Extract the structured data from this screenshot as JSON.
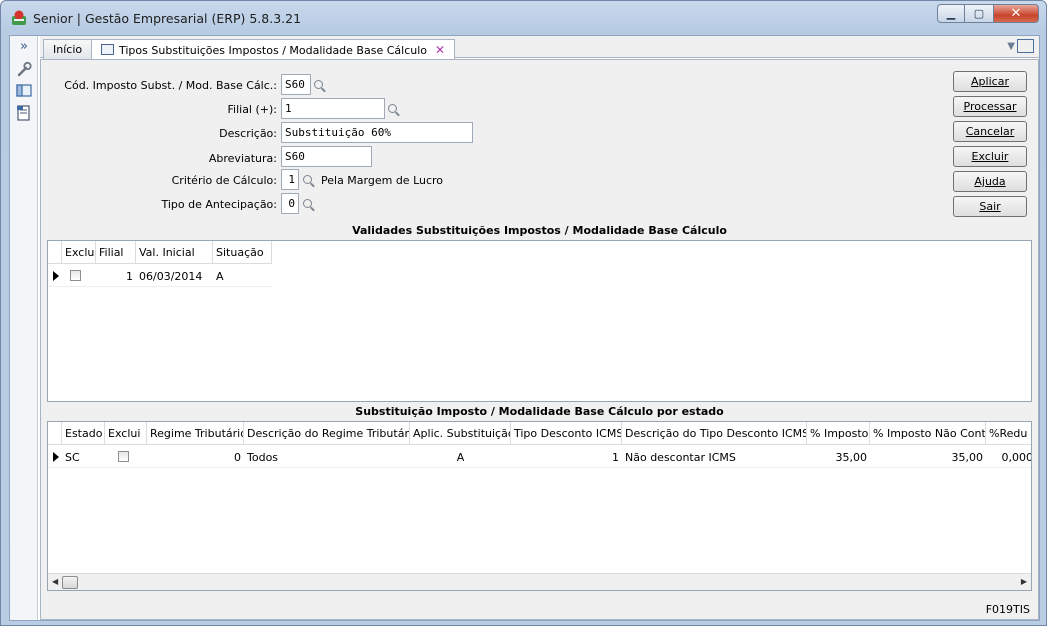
{
  "window": {
    "title": "Senior | Gestão Empresarial (ERP) 5.8.3.21",
    "minimize": "▁",
    "maximize": "▢",
    "close": "✕"
  },
  "tabs": [
    {
      "label": "Início"
    },
    {
      "label": "Tipos Substituições Impostos / Modalidade Base Cálculo"
    }
  ],
  "form": {
    "cod_label": "Cód. Imposto Subst. / Mod. Base Cálc.:",
    "cod_value": "S60",
    "filial_label": "Filial (+):",
    "filial_value": "1",
    "descricao_label": "Descrição:",
    "descricao_value": "Substituição 60%",
    "abreviatura_label": "Abreviatura:",
    "abreviatura_value": "S60",
    "criterio_label": "Critério de Cálculo:",
    "criterio_value": "1",
    "criterio_desc": "Pela Margem de Lucro",
    "antecipacao_label": "Tipo de Antecipação:",
    "antecipacao_value": "0"
  },
  "buttons": {
    "aplicar": "Aplicar",
    "processar": "Processar",
    "cancelar": "Cancelar",
    "excluir": "Excluir",
    "ajuda": "Ajuda",
    "sair": "Sair"
  },
  "grid1": {
    "title": "Validades Substituições Impostos / Modalidade Base Cálculo",
    "columns": [
      "Exclui",
      "Filial",
      "Val. Inicial",
      "Situação"
    ],
    "rows": [
      {
        "exclui": false,
        "filial": "1",
        "val_inicial": "06/03/2014",
        "situacao": "A"
      }
    ]
  },
  "grid2": {
    "title": "Substituição Imposto / Modalidade Base Cálculo por estado",
    "columns": [
      "Estado",
      "Exclui",
      "Regime Tributário",
      "Descrição do Regime Tributário",
      "Aplic. Substituição",
      "Tipo Desconto ICMS",
      "Descrição do Tipo Desconto ICMS",
      "% Imposto",
      "% Imposto Não Cont.",
      "%Redu"
    ],
    "rows": [
      {
        "estado": "SC",
        "exclui": false,
        "regime": "0",
        "regime_desc": "Todos",
        "aplic": "A",
        "tipo_desconto": "1",
        "tipo_desconto_desc": "Não descontar ICMS",
        "imposto": "35,00",
        "imposto_nao_cont": "35,00",
        "reducao": "0,000"
      }
    ]
  },
  "status_code": "F019TIS"
}
